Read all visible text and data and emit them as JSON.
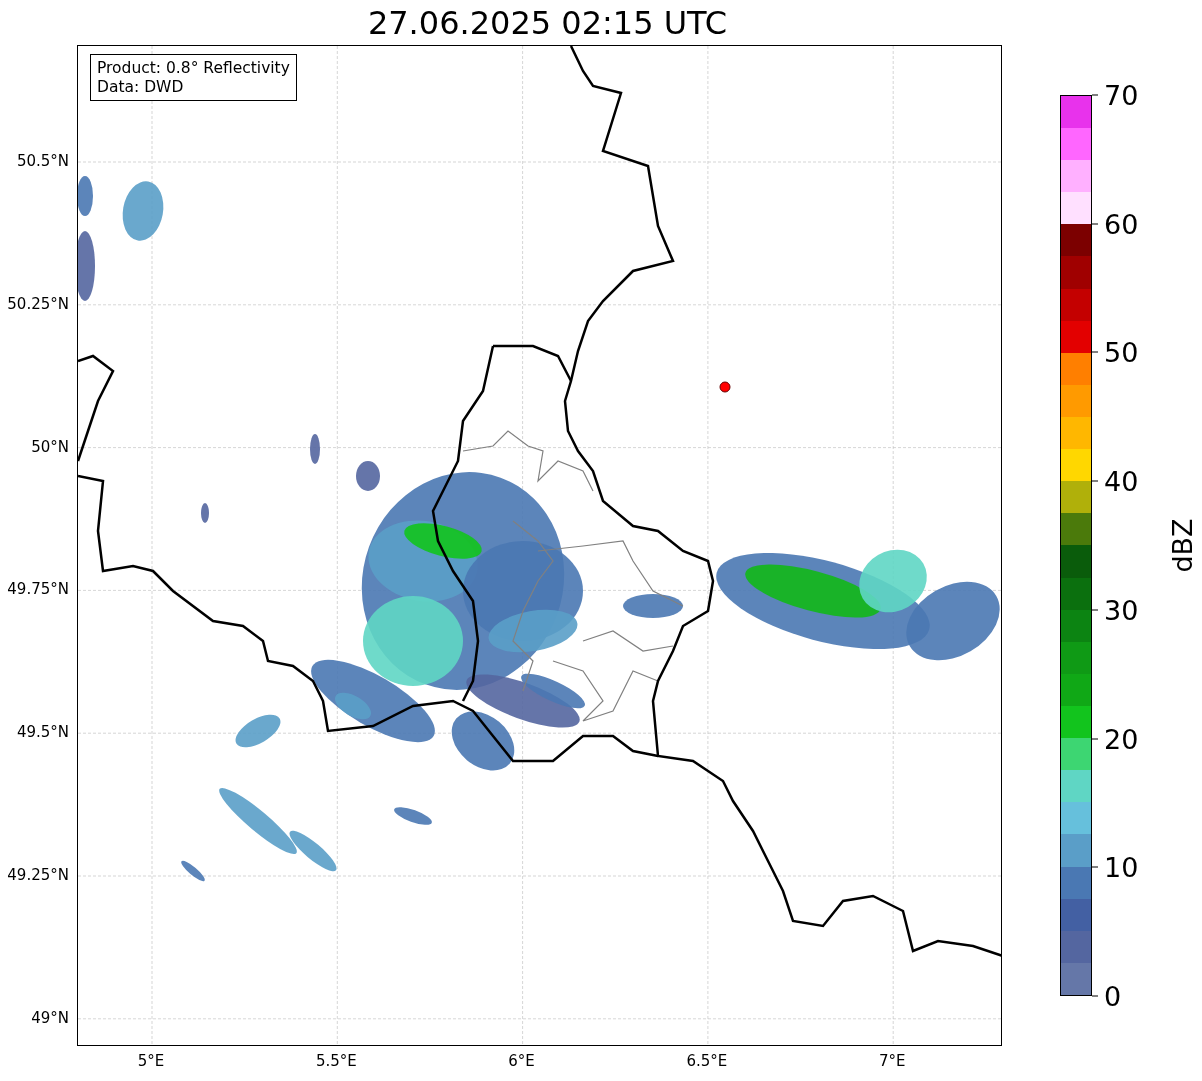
{
  "title": "27.06.2025 02:15 UTC",
  "info_box": {
    "lines": [
      "Product: 0.8° Reflectivity",
      "Data: DWD"
    ]
  },
  "map": {
    "y_tick_labels": [
      "50.5°N",
      "50.25°N",
      "50°N",
      "49.75°N",
      "49.5°N",
      "49.25°N",
      "49°N"
    ],
    "x_tick_labels": [
      "5°E",
      "5.5°E",
      "6°E",
      "6.5°E",
      "7°E"
    ]
  },
  "colorbar": {
    "label": "dBZ",
    "tick_labels": [
      "70",
      "60",
      "50",
      "40",
      "30",
      "20",
      "10",
      "0"
    ],
    "segments": [
      {
        "color": "#6577a8"
      },
      {
        "color": "#5466a0"
      },
      {
        "color": "#4360a3"
      },
      {
        "color": "#4a78b3"
      },
      {
        "color": "#5a9ec8"
      },
      {
        "color": "#66c0dc"
      },
      {
        "color": "#5fd6c4"
      },
      {
        "color": "#3dd672"
      },
      {
        "color": "#12c41d"
      },
      {
        "color": "#10a816"
      },
      {
        "color": "#0f9a15"
      },
      {
        "color": "#0c8412"
      },
      {
        "color": "#0b700e"
      },
      {
        "color": "#0a5c0b"
      },
      {
        "color": "#4b7a0b"
      },
      {
        "color": "#b0b00a"
      },
      {
        "color": "#ffd700"
      },
      {
        "color": "#ffb700"
      },
      {
        "color": "#ff9a00"
      },
      {
        "color": "#ff7f00"
      },
      {
        "color": "#e30000"
      },
      {
        "color": "#c40000"
      },
      {
        "color": "#a00000"
      },
      {
        "color": "#7c0000"
      },
      {
        "color": "#ffe0ff"
      },
      {
        "color": "#ffb0ff"
      },
      {
        "color": "#ff66ff"
      },
      {
        "color": "#e832ec"
      }
    ]
  }
}
